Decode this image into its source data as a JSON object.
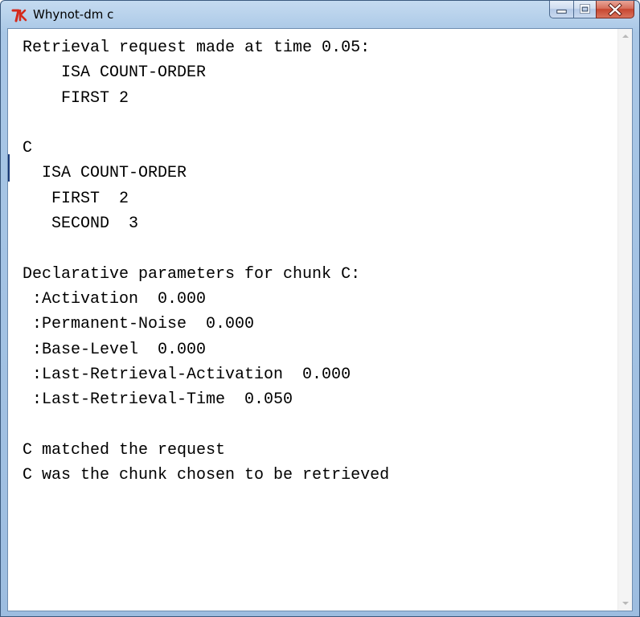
{
  "window": {
    "title": "Whynot-dm c",
    "icon": "tk-feather-icon"
  },
  "caption_buttons": {
    "minimize": "minimize-icon",
    "maximize": "maximize-icon",
    "close": "close-icon"
  },
  "text_lines": [
    {
      "text": "Retrieval request made at time 0.05:",
      "indent": 0
    },
    {
      "text": "ISA COUNT-ORDER",
      "indent": 4
    },
    {
      "text": "FIRST 2",
      "indent": 4
    },
    {
      "text": "",
      "indent": 0
    },
    {
      "text": "C",
      "indent": 0
    },
    {
      "text": "ISA COUNT-ORDER",
      "indent": 2
    },
    {
      "text": "FIRST  2",
      "indent": 3
    },
    {
      "text": "SECOND  3",
      "indent": 3
    },
    {
      "text": "",
      "indent": 0
    },
    {
      "text": "Declarative parameters for chunk C:",
      "indent": 0
    },
    {
      "text": ":Activation  0.000",
      "indent": 1
    },
    {
      "text": ":Permanent-Noise  0.000",
      "indent": 1
    },
    {
      "text": ":Base-Level  0.000",
      "indent": 1
    },
    {
      "text": ":Last-Retrieval-Activation  0.000",
      "indent": 1
    },
    {
      "text": ":Last-Retrieval-Time  0.050",
      "indent": 1
    },
    {
      "text": "",
      "indent": 0
    },
    {
      "text": "C matched the request",
      "indent": 0
    },
    {
      "text": "C was the chunk chosen to be retrieved",
      "indent": 0
    }
  ],
  "colors": {
    "close_button": "#c74630",
    "title_bar": "#a9c7e6"
  }
}
